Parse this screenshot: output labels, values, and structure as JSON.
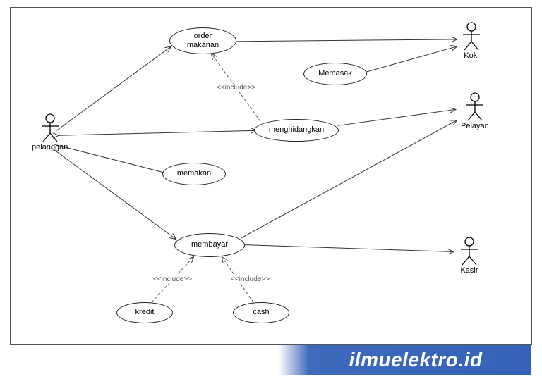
{
  "actors": {
    "pelanggan": "pelanggan",
    "koki": "Koki",
    "pelayan": "Pelayan",
    "kasir": "Kasir"
  },
  "usecases": {
    "order": "order\nmakanan",
    "memasak": "Memasak",
    "menghidangkan": "menghidangkan",
    "memakan": "memakan",
    "membayar": "membayar",
    "kredit": "kredit",
    "cash": "cash"
  },
  "stereotypes": {
    "include1": "<<include>>",
    "include2": "<<include>>",
    "include3": "<<include>>"
  },
  "watermark": "ilmuelektro.id"
}
